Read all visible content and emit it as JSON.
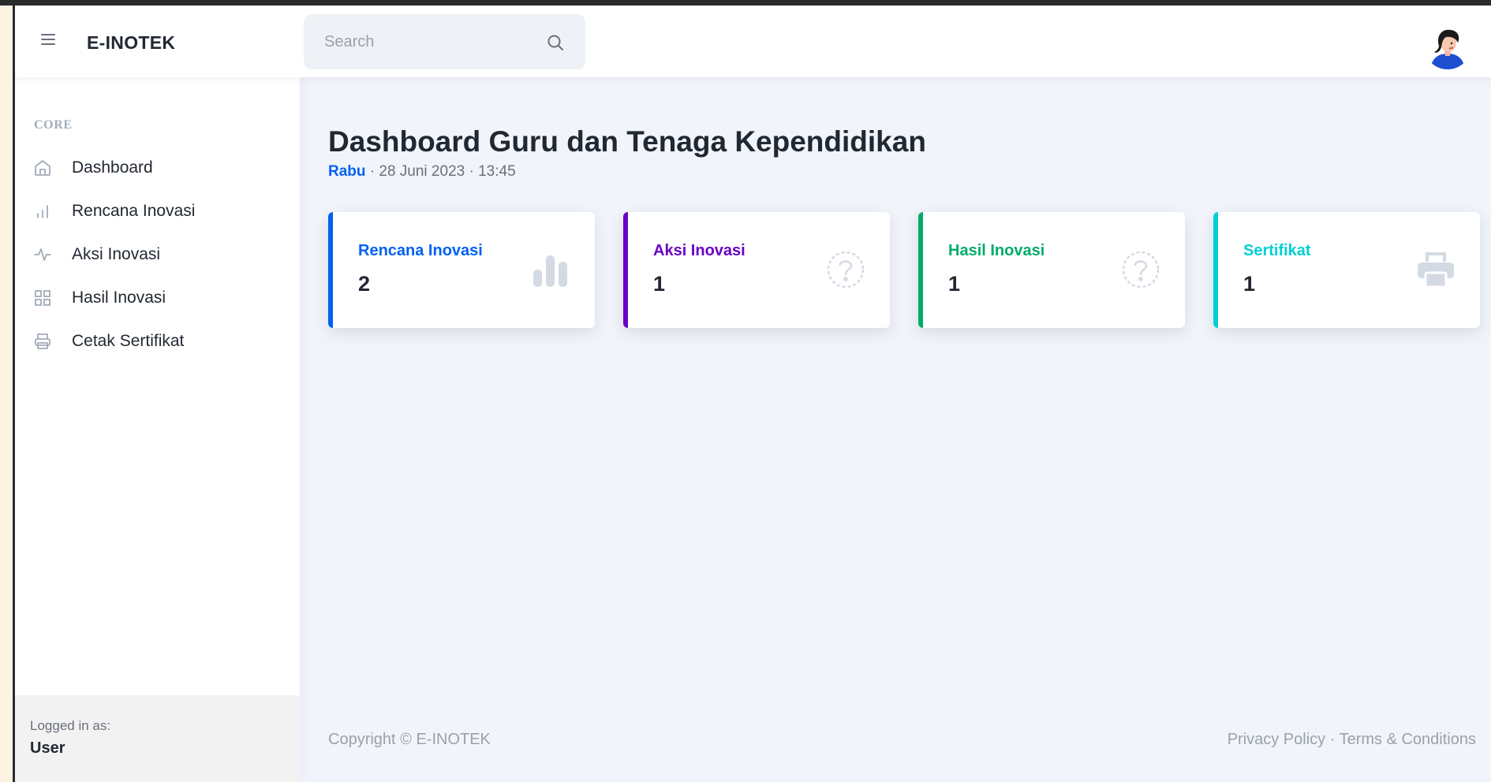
{
  "topnav": {
    "brand": "E-INOTEK",
    "search": {
      "placeholder": "Search",
      "value": ""
    }
  },
  "sidebar": {
    "heading": "CORE",
    "items": [
      {
        "label": "Dashboard",
        "icon": "home-icon"
      },
      {
        "label": "Rencana Inovasi",
        "icon": "bar-chart-icon"
      },
      {
        "label": "Aksi Inovasi",
        "icon": "activity-icon"
      },
      {
        "label": "Hasil Inovasi",
        "icon": "grid-icon"
      },
      {
        "label": "Cetak Sertifikat",
        "icon": "printer-icon"
      }
    ],
    "footer": {
      "subtitle": "Logged in as:",
      "user": "User"
    }
  },
  "main": {
    "title": "Dashboard Guru dan Tenaga Kependidikan",
    "day": "Rabu",
    "datetime": " · 28 Juni 2023 · 13:45",
    "cards": [
      {
        "label": "Rencana Inovasi",
        "value": "2",
        "accent": "#0061f2",
        "icon": "bar-chart-icon"
      },
      {
        "label": "Aksi Inovasi",
        "value": "1",
        "accent": "#6900c7",
        "icon": "question-circle-icon"
      },
      {
        "label": "Hasil Inovasi",
        "value": "1",
        "accent": "#00ac69",
        "icon": "question-circle-icon"
      },
      {
        "label": "Sertifikat",
        "value": "1",
        "accent": "#00cfd5",
        "icon": "printer-icon"
      }
    ]
  },
  "footer": {
    "copyright": "Copyright © E-INOTEK",
    "privacy": "Privacy Policy",
    "separator": " · ",
    "terms": "Terms & Conditions"
  }
}
